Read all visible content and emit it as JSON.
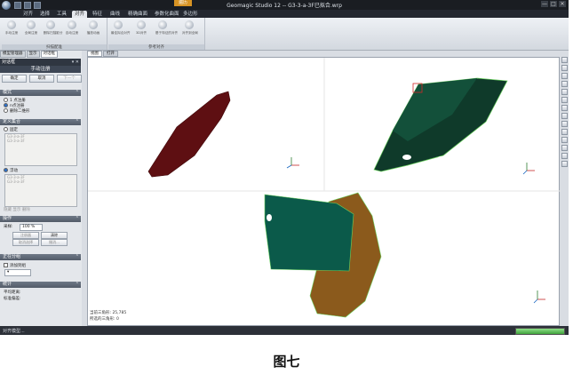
{
  "titlebar": {
    "title": "Geomagic Studio 12 -- G3-3-a-3F已拟合.wrp",
    "highlight_tab": "遍历",
    "controls": [
      "—",
      "□",
      "✕"
    ]
  },
  "menu": {
    "tabs": [
      "对齐",
      "选择",
      "工具",
      "对齐",
      "特征",
      "曲线",
      "精确曲面",
      "参数化曲面",
      "多边形"
    ],
    "active_index": 3
  },
  "ribbon": {
    "groups": [
      {
        "label": "扫描配准",
        "buttons": [
          "手动注册",
          "全局注册",
          "删除扫描影分",
          "自动注册",
          "播放动画"
        ]
      },
      {
        "label": "参考对齐",
        "buttons": [
          "最佳拟合对齐",
          "3D对齐",
          "基于特征的对齐",
          "对齐到全局"
        ]
      }
    ]
  },
  "leftpanel": {
    "tabs": [
      "模型管理器",
      "显示",
      "对话框"
    ],
    "active_tab": 2,
    "dialog_header": "对话框",
    "dialog_title": "手动注册",
    "ok_label": "确定",
    "cancel_label": "取消",
    "next_label": "下一个",
    "mode": {
      "title": "模式",
      "options": [
        "1 点注册",
        "n点注册",
        "删除二维形"
      ],
      "selected": 1
    },
    "define_sets": {
      "title": "定义集合",
      "fixed_label": "固定",
      "fixed_items": [
        "G3-3-a-3F",
        "G3-3-a-3F"
      ],
      "floating_label": "浮动",
      "floating_items": [
        "G3-3-a-3F",
        "G3-3-a-3F"
      ],
      "footer": "隐藏 显示 删除"
    },
    "operation": {
      "title": "操作",
      "sampling_label": "采样:",
      "sampling_value": "100 %",
      "register_btn": "注册器",
      "clear_btn": "清除",
      "reset_btn": "取消选择",
      "more_btn": "撤消..."
    },
    "noise": {
      "title": "正在分组",
      "checkbox": "添加到组"
    },
    "stats": {
      "title": "统计",
      "avg_label": "平均距离:",
      "std_label": "标准偏差:"
    }
  },
  "viewport": {
    "tabs": [
      "视图",
      "打开"
    ],
    "active_tab": 0,
    "readout_1": "当前三角形: 25,785",
    "readout_2": "所选的三角形: 0"
  },
  "status": {
    "text": "对齐模型...",
    "progress": 1.0
  },
  "caption": "图七",
  "colors": {
    "dark_red": "#5e0f12",
    "dark_green": "#0f3a2a",
    "teal": "#0b5a4a",
    "amber": "#8b5a1c",
    "selection": "#d32a2a"
  }
}
